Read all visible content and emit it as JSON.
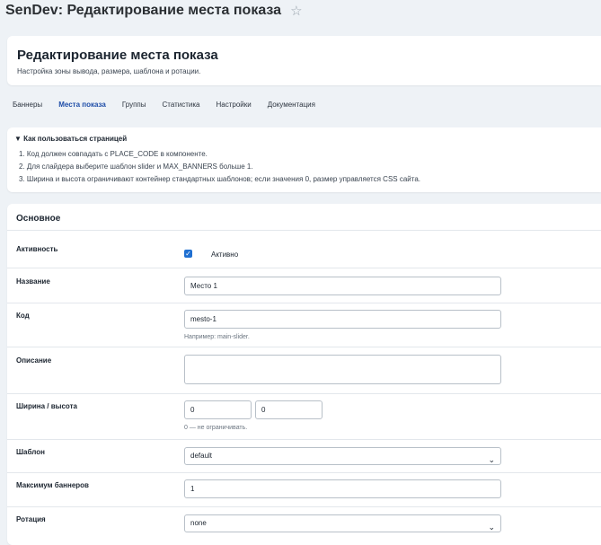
{
  "window": {
    "title": "SenDev: Редактирование места показа"
  },
  "header": {
    "title": "Редактирование места показа",
    "subtitle": "Настройка зоны вывода, размера, шаблона и ротации."
  },
  "tabs": [
    {
      "label": "Баннеры"
    },
    {
      "label": "Места показа"
    },
    {
      "label": "Группы"
    },
    {
      "label": "Статистика"
    },
    {
      "label": "Настройки"
    },
    {
      "label": "Документация"
    }
  ],
  "help": {
    "summary": "▼ Как пользоваться страницей",
    "items": [
      "1. Код должен совпадать с PLACE_CODE в компоненте.",
      "2. Для слайдера выберите шаблон slider и MAX_BANNERS больше 1.",
      "3. Ширина и высота ограничивают контейнер стандартных шаблонов; если значения 0, размер управляется CSS сайта."
    ]
  },
  "form": {
    "section_title": "Основное",
    "active": {
      "label": "Активность",
      "checkbox_label": "Активно",
      "checked": true
    },
    "name": {
      "label": "Название",
      "value": "Место 1"
    },
    "code": {
      "label": "Код",
      "value": "mesto-1",
      "hint": "Например: main-slider."
    },
    "description": {
      "label": "Описание",
      "value": ""
    },
    "size": {
      "label": "Ширина / высота",
      "width": "0",
      "height": "0",
      "hint": "0 — не ограничивать."
    },
    "template": {
      "label": "Шаблон",
      "value": "default"
    },
    "max_banners": {
      "label": "Максимум баннеров",
      "value": "1"
    },
    "rotation": {
      "label": "Ротация",
      "value": "none"
    }
  }
}
